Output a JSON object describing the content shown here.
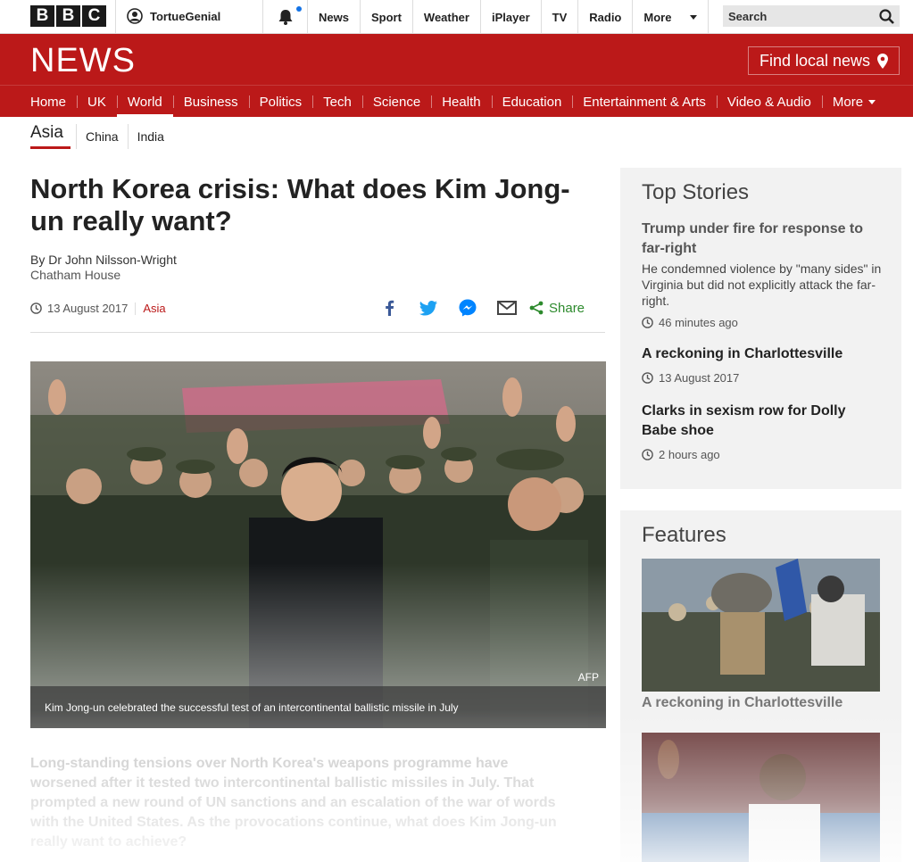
{
  "topbar": {
    "logo_letters": [
      "B",
      "B",
      "C"
    ],
    "account_name": "TortueGenial",
    "nav": [
      "News",
      "Sport",
      "Weather",
      "iPlayer",
      "TV",
      "Radio"
    ],
    "more_label": "More",
    "search_label": "Search"
  },
  "header": {
    "logo": "NEWS",
    "find_local": "Find local news"
  },
  "nav": {
    "items": [
      "Home",
      "UK",
      "World",
      "Business",
      "Politics",
      "Tech",
      "Science",
      "Health",
      "Education",
      "Entertainment & Arts",
      "Video & Audio"
    ],
    "active": "World",
    "more_label": "More"
  },
  "subnav": {
    "current": "Asia",
    "items": [
      "China",
      "India"
    ]
  },
  "article": {
    "headline": "North Korea crisis: What does Kim Jong-un really want?",
    "author": "By Dr John Nilsson-Wright",
    "organisation": "Chatham House",
    "date": "13 August 2017",
    "tag": "Asia",
    "share_label": "Share",
    "image_credit": "AFP",
    "image_caption": "Kim Jong-un celebrated the successful test of an intercontinental ballistic missile in July",
    "intro": "Long-standing tensions over North Korea's weapons programme have worsened after it tested two intercontinental ballistic missiles in July. That prompted a new round of UN sanctions and an escalation of the war of words with the United States. As the provocations continue, what does Kim Jong-un really want to achieve?"
  },
  "top_stories": {
    "heading": "Top Stories",
    "stories": [
      {
        "title": "Trump under fire for response to far-right",
        "summary": "He condemned violence by \"many sides\" in Virginia but did not explicitly attack the far-right.",
        "time": "46 minutes ago"
      },
      {
        "title": "A reckoning in Charlottesville",
        "time": "13 August 2017"
      },
      {
        "title": "Clarks in sexism row for Dolly Babe shoe",
        "time": "2 hours ago"
      }
    ]
  },
  "features": {
    "heading": "Features",
    "items": [
      {
        "title": "A reckoning in Charlottesville"
      }
    ]
  },
  "colors": {
    "brand_red": "#bb1919",
    "share_green": "#2d8a2d",
    "facebook_blue": "#3b5998",
    "twitter_blue": "#1da1f2",
    "messenger_blue": "#0084ff"
  }
}
